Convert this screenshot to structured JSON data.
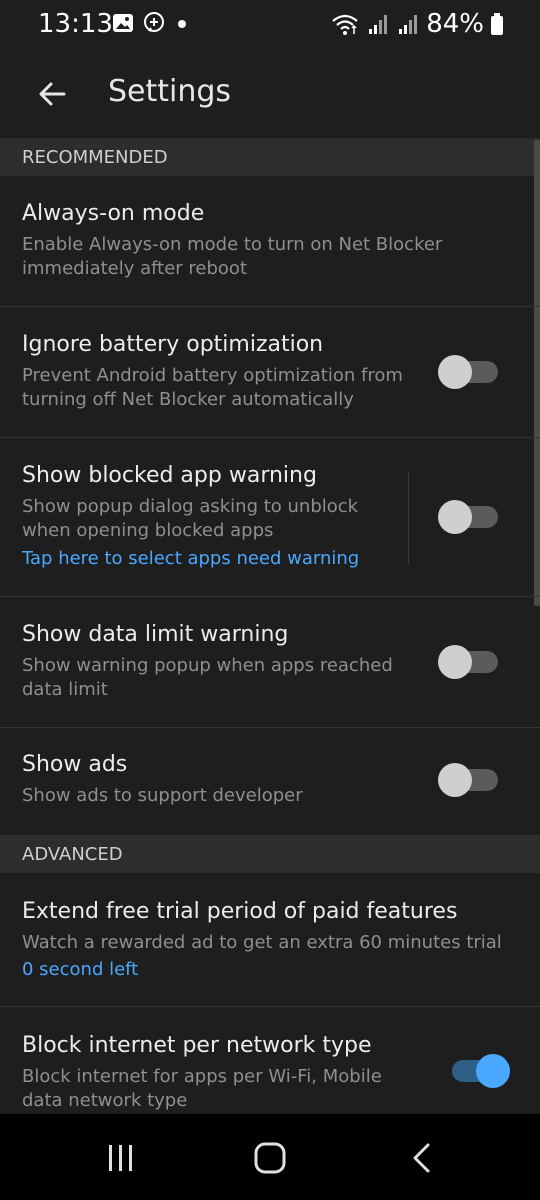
{
  "status_bar": {
    "time": "13:13",
    "icons": [
      "gallery-icon",
      "messenger-icon",
      "dot-icon",
      "wifi-icon",
      "signal-icon",
      "signal-icon",
      "battery-icon"
    ],
    "battery_text": "84%"
  },
  "app_bar": {
    "title": "Settings",
    "back_icon": "arrow-left-icon"
  },
  "sections": {
    "recommended": {
      "header": "RECOMMENDED",
      "always_on": {
        "title": "Always-on mode",
        "summary_line1": "Enable Always-on mode to turn on Net Blocker",
        "summary_line2": "immediately after reboot"
      },
      "battery": {
        "title": "Ignore battery optimization",
        "summary_line1": "Prevent Android battery optimization from",
        "summary_line2": "turning off Net Blocker automatically",
        "enabled": false
      },
      "blocked_app_warning": {
        "title": "Show blocked app warning",
        "summary_line1": "Show popup dialog asking to unblock",
        "summary_line2": "when opening blocked apps",
        "link": "Tap here to select apps need warning",
        "enabled": false
      },
      "data_limit_warning": {
        "title": "Show data limit warning",
        "summary_line1": "Show warning popup when apps reached",
        "summary_line2": "data limit",
        "enabled": false
      },
      "show_ads": {
        "title": "Show ads",
        "summary_line1": "Show ads to support developer",
        "enabled": false
      }
    },
    "advanced": {
      "header": "ADVANCED",
      "extend_trial": {
        "title": "Extend free trial period of paid features",
        "summary_line1": "Watch a rewarded ad to get an extra 60 minutes trial",
        "link": "0 second left"
      },
      "block_per_network": {
        "title": "Block internet per network type",
        "summary_line1": "Block internet for apps per Wi-Fi, Mobile",
        "summary_line2": "data network type",
        "enabled": true
      }
    }
  },
  "nav_bar": {
    "recents_icon": "recents-icon",
    "home_icon": "home-icon",
    "back_icon": "back-icon"
  },
  "colors": {
    "background": "#1e1e1e",
    "section_header": "#2d2d2d",
    "accent": "#4aa8ff",
    "summary_text": "#8f8f8f"
  }
}
